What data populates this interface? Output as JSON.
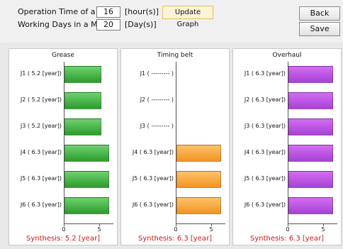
{
  "form": {
    "op_time_label": "Operation Time of a Day :",
    "op_time_value": "16",
    "op_time_unit": "[hour(s)]",
    "work_days_label": "Working Days in a Month :",
    "work_days_value": "20",
    "work_days_unit": "[Day(s)]",
    "update_label": "Update Graph",
    "back_label": "Back",
    "save_label": "Save"
  },
  "colors": {
    "green": "#2c9b2c",
    "orange": "#f29422",
    "purple": "#a543d6",
    "synthesis": "#d21414"
  },
  "chart_data": [
    {
      "type": "bar",
      "title": "Grease",
      "categories": [
        "J1 ( 5.2 [year])",
        "J2 ( 5.2 [year])",
        "J3 ( 5.2 [year])",
        "J4 ( 6.3 [year])",
        "J5 ( 6.3 [year])",
        "J6 ( 6.3 [year])"
      ],
      "values": [
        5.2,
        5.2,
        5.2,
        6.3,
        6.3,
        6.3
      ],
      "xlim": [
        0,
        7
      ],
      "x_ticks": [
        "0",
        "5"
      ],
      "synthesis": "Synthesis: 5.2 [year]"
    },
    {
      "type": "bar",
      "title": "Timing belt",
      "categories": [
        "J1 ( --------- )",
        "J2 ( --------- )",
        "J3 ( --------- )",
        "J4 ( 6.3 [year])",
        "J5 ( 6.3 [year])",
        "J6 ( 6.3 [year])"
      ],
      "values": [
        null,
        null,
        null,
        6.3,
        6.3,
        6.3
      ],
      "xlim": [
        0,
        7
      ],
      "x_ticks": [
        "0",
        "5"
      ],
      "synthesis": "Synthesis: 6.3 [year]"
    },
    {
      "type": "bar",
      "title": "Overhaul",
      "categories": [
        "J1 ( 6.3 [year])",
        "J2 ( 6.3 [year])",
        "J3 ( 6.3 [year])",
        "J4 ( 6.3 [year])",
        "J5 ( 6.3 [year])",
        "J6 ( 6.3 [year])"
      ],
      "values": [
        6.3,
        6.3,
        6.3,
        6.3,
        6.3,
        6.3
      ],
      "xlim": [
        0,
        7
      ],
      "x_ticks": [
        "0",
        "5"
      ],
      "synthesis": "Synthesis: 6.3 [year]"
    }
  ]
}
